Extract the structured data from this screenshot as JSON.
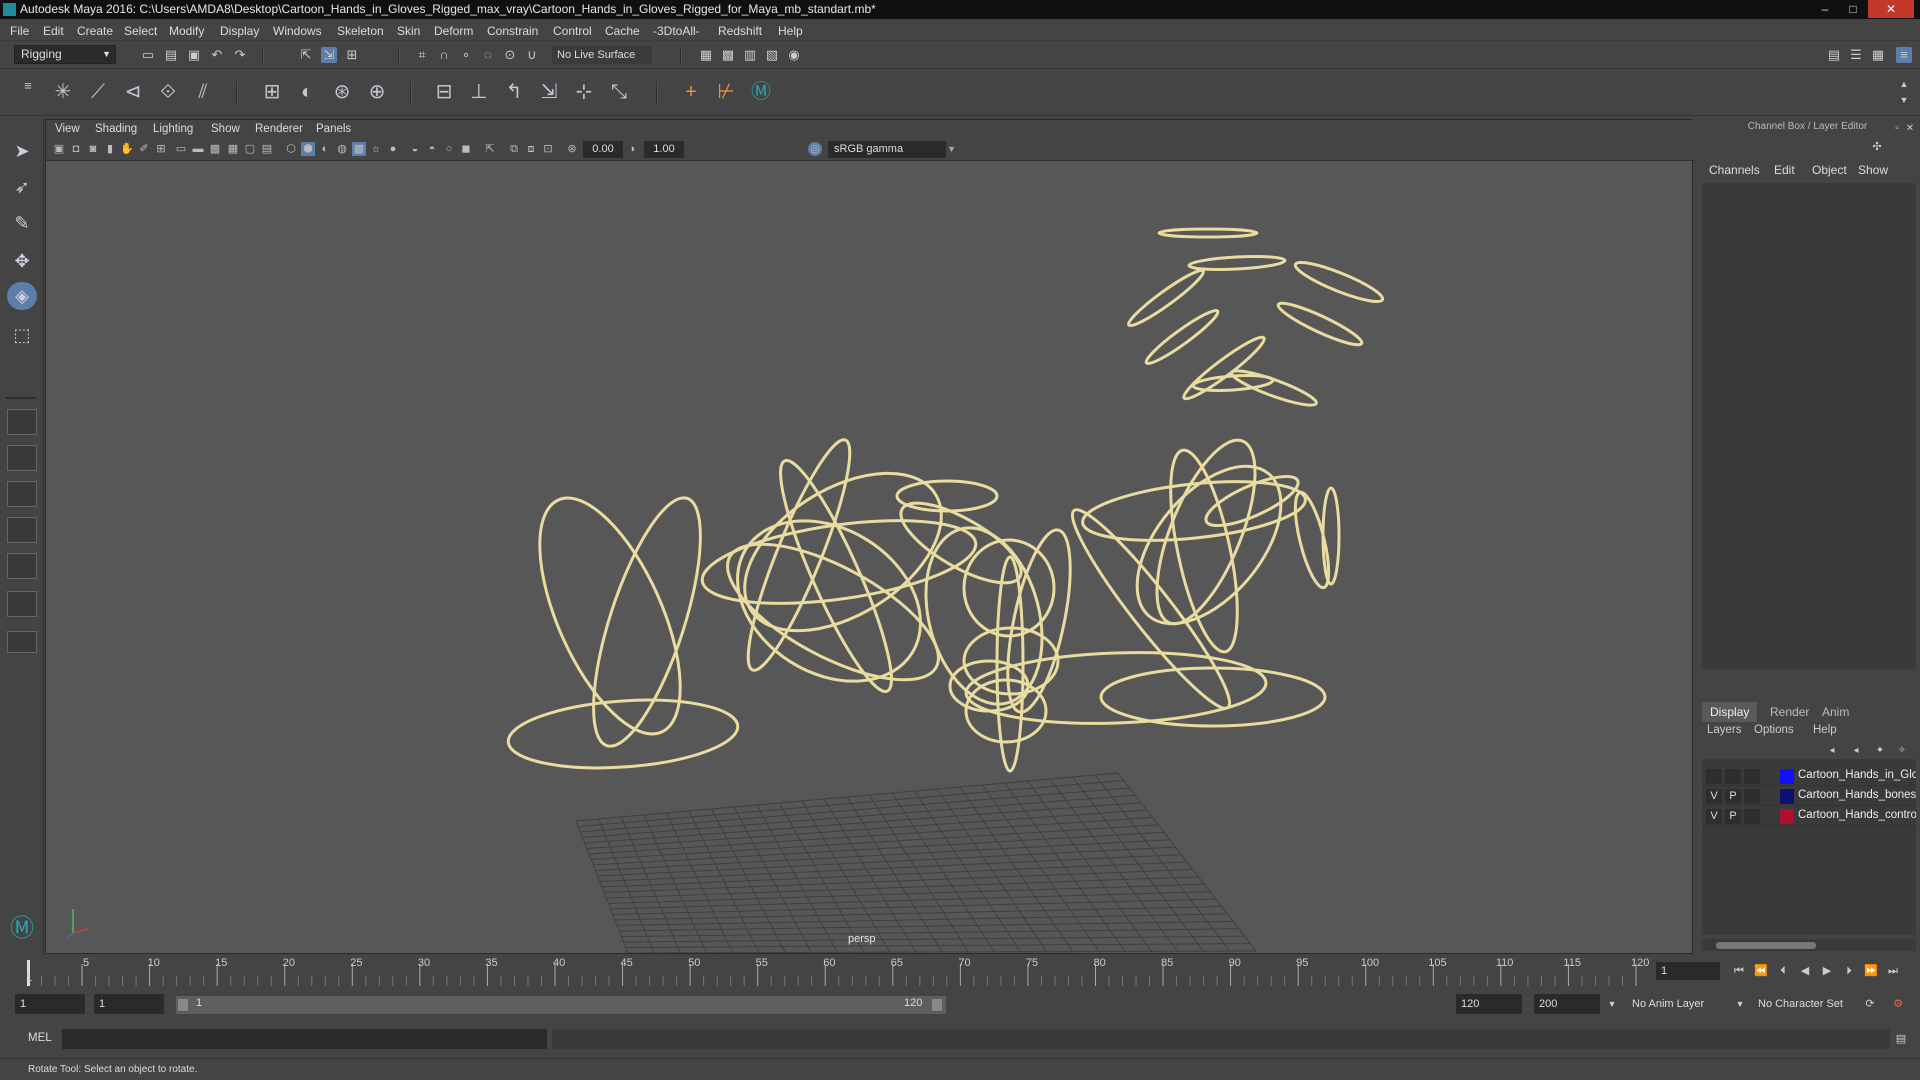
{
  "window": {
    "title": "Autodesk Maya 2016: C:\\Users\\AMDA8\\Desktop\\Cartoon_Hands_in_Gloves_Rigged_max_vray\\Cartoon_Hands_in_Gloves_Rigged_for_Maya_mb_standart.mb*",
    "minimize": "–",
    "maximize": "□",
    "close": "✕"
  },
  "menubar": [
    "File",
    "Edit",
    "Create",
    "Select",
    "Modify",
    "Display",
    "Windows",
    "Skeleton",
    "Skin",
    "Deform",
    "Constrain",
    "Control",
    "Cache",
    "-3DtoAll-",
    "Redshift",
    "Help"
  ],
  "toolbar": {
    "mode": "Rigging",
    "live_surface": "No Live Surface"
  },
  "panel": {
    "menus": [
      "View",
      "Shading",
      "Lighting",
      "Show",
      "Renderer",
      "Panels"
    ],
    "exposure": "0.00",
    "gamma": "1.00",
    "color_space": "sRGB gamma",
    "camera": "persp"
  },
  "channel_box": {
    "header": "Channel Box / Layer Editor",
    "tabs": [
      "Channels",
      "Edit",
      "Object",
      "Show"
    ]
  },
  "layer_editor": {
    "tabs": [
      "Display",
      "Render",
      "Anim"
    ],
    "active_tab": "Display",
    "menus": [
      "Layers",
      "Options",
      "Help"
    ],
    "layers": [
      {
        "v": "",
        "p": "",
        "name": "Cartoon_Hands_in_Gloves",
        "color": "#1010ff"
      },
      {
        "v": "V",
        "p": "P",
        "name": "Cartoon_Hands_bones",
        "color": "#101070"
      },
      {
        "v": "V",
        "p": "P",
        "name": "Cartoon_Hands_controllers",
        "color": "#b01030"
      }
    ]
  },
  "timeline": {
    "ticks": [
      "5",
      "10",
      "15",
      "20",
      "25",
      "30",
      "35",
      "40",
      "45",
      "50",
      "55",
      "60",
      "65",
      "70",
      "75",
      "80",
      "85",
      "90",
      "95",
      "100",
      "105",
      "110",
      "115",
      "120"
    ],
    "start_label": "1",
    "current_frame": "1"
  },
  "range": {
    "start": "1",
    "playback_start": "1",
    "slider_start": "1",
    "slider_end": "120",
    "playback_end": "120",
    "end": "200",
    "anim_layer": "No Anim Layer",
    "character_set": "No Character Set"
  },
  "command": {
    "label": "MEL"
  },
  "help_line": "Rotate Tool: Select an object to rotate.",
  "colors": {
    "curve": "#e8dca0",
    "curve_dark": "#7a7050",
    "accent": "#5d7ea8"
  }
}
